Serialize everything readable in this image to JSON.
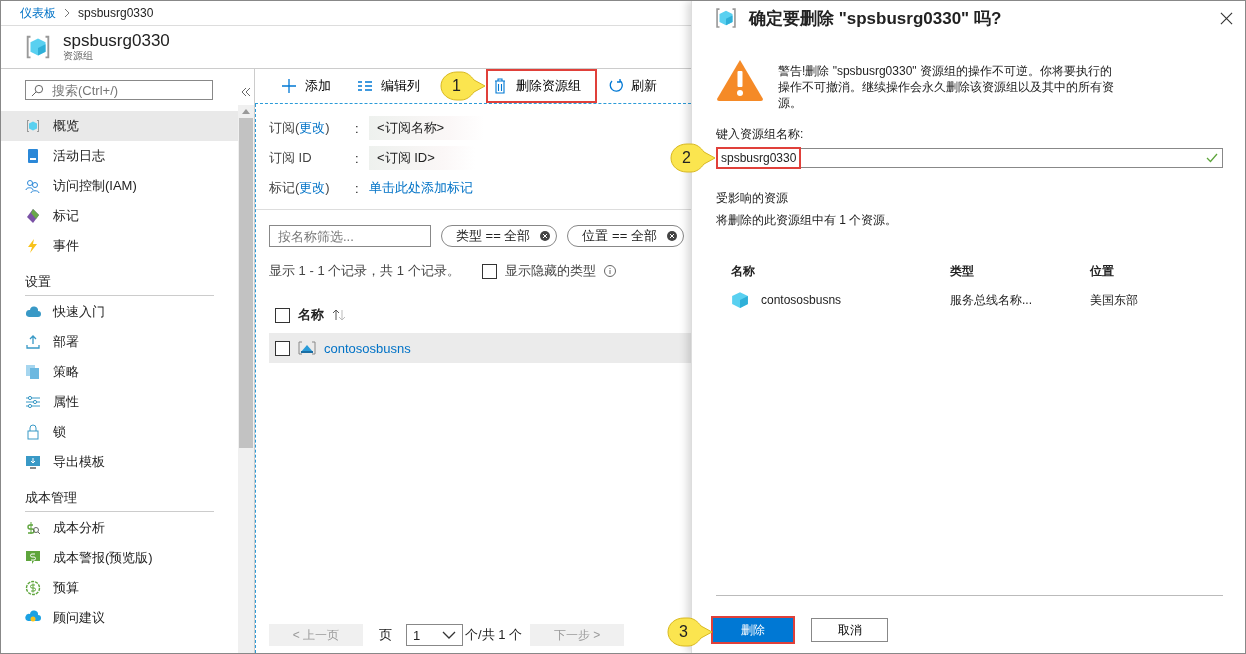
{
  "breadcrumb": [
    {
      "label": "仪表板",
      "link": true
    },
    {
      "label": "spsbusrg0330",
      "link": false
    }
  ],
  "header": {
    "title": "spsbusrg0330",
    "subtitle": "资源组"
  },
  "sidebar": {
    "search": {
      "placeholder": "搜索(Ctrl+/)"
    },
    "sections": [
      {
        "items": [
          {
            "label": "概览",
            "selected": true
          },
          {
            "label": "活动日志",
            "selected": false
          },
          {
            "label": "访问控制(IAM)",
            "selected": false
          },
          {
            "label": "标记",
            "selected": false
          },
          {
            "label": "事件",
            "selected": false
          }
        ]
      },
      {
        "heading": "设置",
        "items": [
          {
            "label": "快速入门",
            "selected": false
          },
          {
            "label": "部署",
            "selected": false
          },
          {
            "label": "策略",
            "selected": false
          },
          {
            "label": "属性",
            "selected": false
          },
          {
            "label": "锁",
            "selected": false
          },
          {
            "label": "导出模板",
            "selected": false
          }
        ]
      },
      {
        "heading": "成本管理",
        "items": [
          {
            "label": "成本分析",
            "selected": false
          },
          {
            "label": "成本警报(预览版)",
            "selected": false
          },
          {
            "label": "预算",
            "selected": false
          },
          {
            "label": "顾问建议",
            "selected": false
          }
        ]
      }
    ]
  },
  "toolbar": [
    {
      "label": "添加",
      "highlighted": false
    },
    {
      "label": "编辑列",
      "highlighted": false
    },
    {
      "label": "删除资源组",
      "highlighted": true,
      "callout": "1"
    },
    {
      "label": "刷新",
      "highlighted": false
    }
  ],
  "essentials": [
    {
      "prefix": "订阅(",
      "link": "更改",
      "suffix": ")",
      "colon": ":",
      "value": "<订阅名称>",
      "kind": "masked"
    },
    {
      "prefix": "订阅 ID",
      "colon": ":",
      "value": "<订阅 ID>",
      "kind": "masked"
    },
    {
      "prefix": "标记(",
      "link": "更改",
      "suffix": ")",
      "colon": ":",
      "value": "单击此处添加标记",
      "kind": "link"
    }
  ],
  "filters": {
    "placeholder": "按名称筛选...",
    "pills": [
      {
        "label": "类型 == 全部"
      },
      {
        "label": "位置 == 全部"
      }
    ]
  },
  "records": {
    "summary": "显示 1 - 1 个记录，共 1 个记录。",
    "show_hidden": {
      "label": "显示隐藏的类型",
      "checked": false
    }
  },
  "table": {
    "columns": [
      {
        "label": "名称"
      }
    ],
    "all_checked": false,
    "rows": [
      {
        "name": "contososbusns",
        "checked": false,
        "highlighted": true
      }
    ]
  },
  "pagination": {
    "prev": "< 上一页",
    "page_label": "页",
    "page": "1",
    "total": "个/共 1 个",
    "next": "下一步 >",
    "prev_disabled": true,
    "next_disabled": true
  },
  "dialog": {
    "title": "确定要删除 \"spsbusrg0330\" 吗?",
    "warning": "警告!删除 \"spsbusrg0330\" 资源组的操作不可逆。你将要执行的操作不可撤消。继续操作会永久删除该资源组以及其中的所有资源。",
    "name_label": "键入资源组名称:",
    "name_value": "spsbusrg0330",
    "name_valid": true,
    "name_highlighted": true,
    "name_callout": "2",
    "affected_heading": "受影响的资源",
    "affected_text": "将删除的此资源组中有 1 个资源。",
    "columns": [
      "名称",
      "类型",
      "位置"
    ],
    "rows": [
      {
        "name": "contososbusns",
        "type": "服务总线名称...",
        "location": "美国东部"
      }
    ],
    "buttons": [
      {
        "label": "删除",
        "kind": "primary",
        "highlighted": true,
        "callout": "3"
      },
      {
        "label": "取消",
        "kind": "secondary",
        "highlighted": false
      }
    ]
  }
}
